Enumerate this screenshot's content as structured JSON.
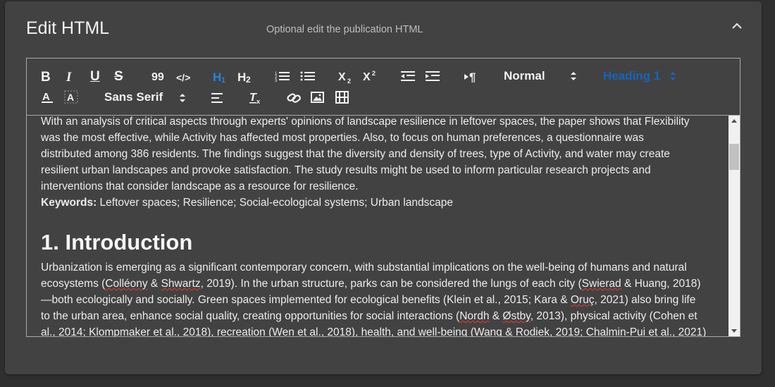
{
  "panel": {
    "title": "Edit HTML",
    "subtitle": "Optional edit the publication HTML",
    "collapse_icon": "chevron-up-icon"
  },
  "toolbar": {
    "bold": "B",
    "italic": "I",
    "underline": "U",
    "strike": "S",
    "quote": "99",
    "code": "</>",
    "h1": "H1",
    "h2": "H2",
    "subscript": "X2",
    "superscript": "X2",
    "paragraph": "¶",
    "format_select": "Normal",
    "heading_select": "Heading 1",
    "font_select": "Sans Serif",
    "accent_color": "#1565c0"
  },
  "content": {
    "intro_lines": [
      "With an analysis of critical aspects through experts' opinions of landscape resilience in leftover spaces, the paper shows that Flexibility",
      "was the most effective, while Activity has affected most properties. Also, to focus on human preferences, a questionnaire was",
      "distributed among 386 residents. The findings suggest that the diversity and density of trees, type of Activity, and water may create",
      "resilient urban landscapes and provoke satisfaction. The study results might be used to inform particular research projects and",
      "interventions that consider landscape as a resource for resilience."
    ],
    "keywords_label": "Keywords:",
    "keywords": " Leftover spaces; Resilience; Social-ecological systems; Urban landscape",
    "heading": "1. Introduction",
    "para_lines": {
      "l1": "Urbanization is emerging as a significant contemporary concern, with substantial implications on the well-being of humans and natural",
      "l2_a": "ecosystems (",
      "l2_b": "Colléony",
      "l2_c": " & ",
      "l2_d": "Shwartz",
      "l2_e": ", 2019). In the urban structure, parks can be considered the lungs of each city (",
      "l2_f": "Swierad",
      "l2_g": " & Huang, 2018)",
      "l3_a": "—both ecologically and socially. Green spaces implemented for ecological benefits (Klein et al., 2015; Kara & ",
      "l3_b": "Oruç",
      "l3_c": ", 2021) also bring life",
      "l4_a": "to the urban area, enhance social quality, creating opportunities for social interactions (",
      "l4_b": "Nordh",
      "l4_c": " & ",
      "l4_d": "Østby",
      "l4_e": ", 2013), physical activity (Cohen et",
      "l5": "al., 2014; Klompmaker et al., 2018), recreation (Wen et al., 2018), health, and well-being (Wang & Rodiek, 2019; Chalmin-Pui et al., 2021)"
    }
  }
}
